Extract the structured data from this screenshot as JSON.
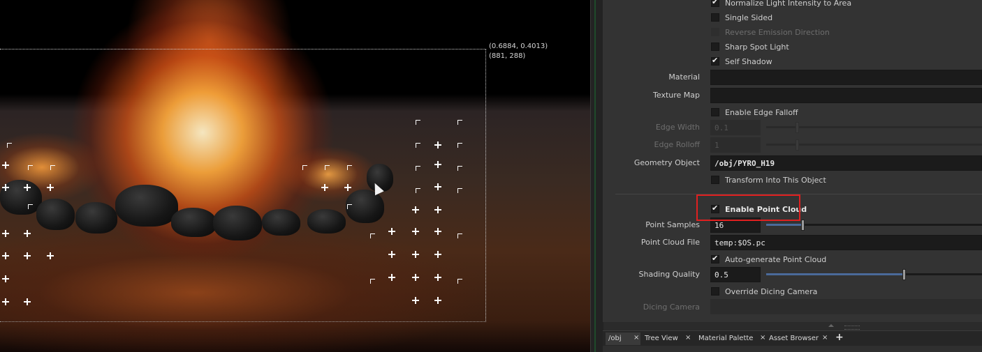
{
  "viewport": {
    "coord_uv": "(0.6884, 0.4013)",
    "coord_px": "(881, 288)"
  },
  "params": {
    "normalize_light": {
      "label": "Normalize Light Intensity to Area",
      "checked": true
    },
    "single_sided": {
      "label": "Single Sided",
      "checked": false
    },
    "reverse_emission": {
      "label": "Reverse Emission Direction",
      "checked": false,
      "disabled": true
    },
    "sharp_spot": {
      "label": "Sharp Spot Light",
      "checked": false
    },
    "self_shadow": {
      "label": "Self Shadow",
      "checked": true
    },
    "material": {
      "label": "Material",
      "value": ""
    },
    "texture_map": {
      "label": "Texture Map",
      "value": ""
    },
    "edge_falloff": {
      "label": "Enable Edge Falloff",
      "checked": false
    },
    "edge_width": {
      "label": "Edge Width",
      "value": "0.1",
      "disabled": true
    },
    "edge_rolloff": {
      "label": "Edge Rolloff",
      "value": "1",
      "disabled": true
    },
    "geometry_object": {
      "label": "Geometry Object",
      "value": "/obj/PYRO_H19"
    },
    "transform_into": {
      "label": "Transform Into This Object",
      "checked": false
    },
    "enable_point_cloud": {
      "label": "Enable Point Cloud",
      "checked": true
    },
    "point_samples": {
      "label": "Point Samples",
      "value": "16"
    },
    "point_cloud_file": {
      "label": "Point Cloud File",
      "value": "temp:$OS.pc"
    },
    "auto_generate": {
      "label": "Auto-generate Point Cloud",
      "checked": true
    },
    "shading_quality": {
      "label": "Shading Quality",
      "value": "0.5"
    },
    "override_dicing": {
      "label": "Override Dicing Camera",
      "checked": false
    },
    "dicing_camera": {
      "label": "Dicing Camera",
      "value": "",
      "disabled": true
    }
  },
  "tabs": [
    {
      "label": "/obj",
      "active": true
    },
    {
      "label": "Tree View",
      "active": false
    },
    {
      "label": "Material Palette",
      "active": false
    },
    {
      "label": "Asset Browser",
      "active": false
    }
  ],
  "tab_close_glyph": "×",
  "tab_add_glyph": "+",
  "colors": {
    "highlight": "#e02020",
    "panel_bg": "#333333",
    "field_bg": "#1b1b1b",
    "slider_fill": "#4a6a9a"
  }
}
